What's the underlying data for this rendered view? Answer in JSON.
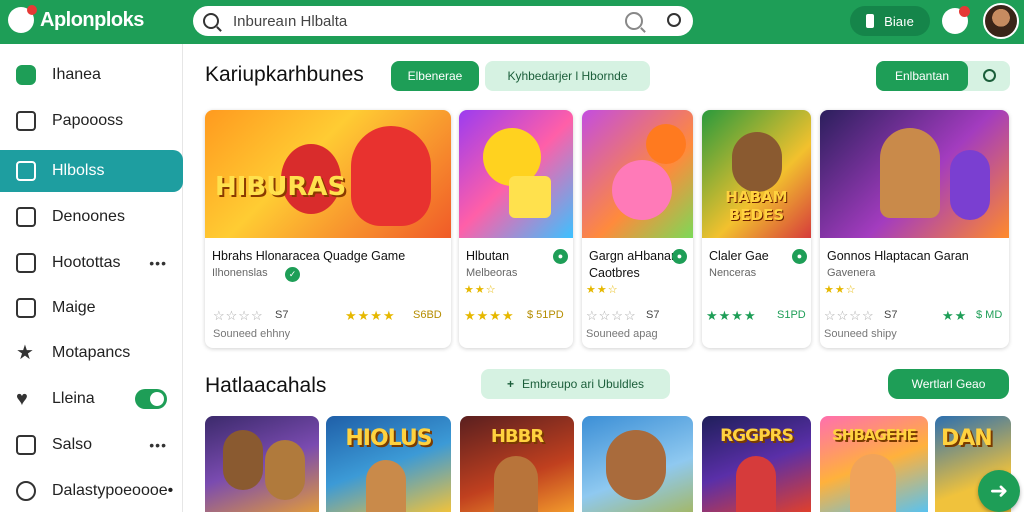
{
  "brand": {
    "name": "Aplonploks",
    "accent": "#1e9e57"
  },
  "search": {
    "value": "Inbureaın Hlbalta",
    "icons": [
      "search-icon",
      "mic-icon",
      "lens-icon"
    ]
  },
  "header": {
    "button_label": "Biaıe"
  },
  "sidebar": {
    "items": [
      {
        "label": "Ihanea",
        "icon": "home-icon"
      },
      {
        "label": "Papoooss",
        "icon": "library-icon"
      },
      {
        "label": "Hlbolss",
        "icon": "games-icon",
        "active": true
      },
      {
        "label": "Denoones",
        "icon": "downloads-icon"
      },
      {
        "label": "Hootottas",
        "icon": "building-icon",
        "more": "•••"
      },
      {
        "label": "Maige",
        "icon": "flag-icon"
      },
      {
        "label": "Motapancs",
        "icon": "star-icon"
      },
      {
        "label": "Lleina",
        "icon": "heart-icon",
        "toggle": true
      },
      {
        "label": "Salso",
        "icon": "chart-icon",
        "more": "•••"
      },
      {
        "label": "Dalastypoeoooe•",
        "icon": "settings-icon"
      }
    ]
  },
  "section1": {
    "title": "Kariupkarhbunes",
    "filters": [
      "Elbenerae",
      "Kyhbedarjer l Hbornde"
    ],
    "action": "Enlbantan"
  },
  "cards": [
    {
      "art_label": "HIBURAS",
      "title": "Hbrahs Hlonaracea Quadge Game",
      "subtitle": "Ilhonenslas",
      "stars_outline": "☆☆☆☆",
      "rating_text": "S7",
      "stars_fill": "★★★★",
      "stars_fill_color": "gold",
      "value": "S6BD",
      "note": "Souneed ehhny"
    },
    {
      "art_label": "",
      "title": "Hlbutan",
      "subtitle": "Melbeoras",
      "stars_small": "★★☆",
      "stars_fill": "★★★★",
      "stars_fill_color": "gold",
      "value": "$ 51PD"
    },
    {
      "art_label": "",
      "title": "Gargn aHbanan Caotbres",
      "subtitle": "",
      "stars_small": "★★☆",
      "stars_outline": "☆☆☆☆",
      "rating_text": "S7",
      "note": "Souneed apag"
    },
    {
      "art_label": "HABAM BEDES",
      "title": "Claler Gae",
      "subtitle": "Nenceras",
      "stars_fill": "★★★★",
      "stars_fill_color": "green",
      "value": "S1PD"
    },
    {
      "art_label": "",
      "title": "Gonnos Hlaptacan Garan",
      "subtitle": "Gavenera",
      "stars_small": "★★☆",
      "stars_outline": "☆☆☆☆",
      "rating_text": "S7",
      "stars_fill": "★★",
      "stars_fill_color": "green",
      "value": "$ MD",
      "note": "Souneed shipy"
    }
  ],
  "section2": {
    "title": "Hatlaacahals",
    "chip": "Embreupo ari Ubuldles",
    "action": "Wertlarl Geao"
  },
  "tiles": [
    {
      "label": ""
    },
    {
      "label": "HIOLUS"
    },
    {
      "label": "HBBR"
    },
    {
      "label": ""
    },
    {
      "label": "RGGPRS"
    },
    {
      "label": "SHBAGEHE"
    },
    {
      "label": "DAN"
    }
  ],
  "fab": {
    "icon": "arrow-right-icon",
    "glyph": "➜"
  }
}
